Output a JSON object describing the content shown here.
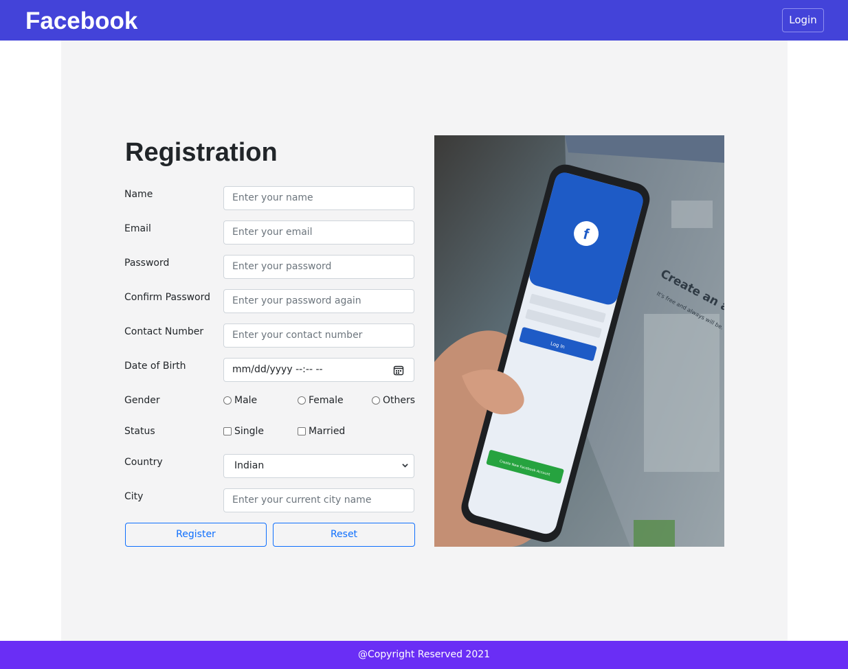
{
  "navbar": {
    "brand": "Facebook",
    "login_label": "Login"
  },
  "form": {
    "title": "Registration",
    "fields": {
      "name": {
        "label": "Name",
        "placeholder": "Enter your name"
      },
      "email": {
        "label": "Email",
        "placeholder": "Enter your email"
      },
      "password": {
        "label": "Password",
        "placeholder": "Enter your password"
      },
      "confirm_password": {
        "label": "Confirm Password",
        "placeholder": "Enter your password again"
      },
      "contact": {
        "label": "Contact Number",
        "placeholder": "Enter your contact number"
      },
      "dob": {
        "label": "Date of Birth",
        "placeholder": "mm/dd/yyyy --:-- --"
      },
      "city": {
        "label": "City",
        "placeholder": "Enter your current city name"
      }
    },
    "gender": {
      "label": "Gender",
      "options": [
        "Male",
        "Female",
        "Others"
      ]
    },
    "status": {
      "label": "Status",
      "options": [
        "Single",
        "Married"
      ]
    },
    "country": {
      "label": "Country",
      "selected": "Indian"
    },
    "buttons": {
      "register": "Register",
      "reset": "Reset"
    }
  },
  "hero_image": {
    "icon": "phone-with-facebook-signup-photo",
    "screen_texts": {
      "login": "Log In",
      "create_account_button": "Create New Facebook Account",
      "monitor_heading": "Create an account",
      "monitor_sub": "It's free and always will be."
    }
  },
  "footer": {
    "text": "@Copyright Reserved 2021"
  },
  "colors": {
    "navbar": "#4343d9",
    "footer": "#6a2ef5",
    "panel": "#f4f4f5",
    "accent": "#0d6efd"
  }
}
